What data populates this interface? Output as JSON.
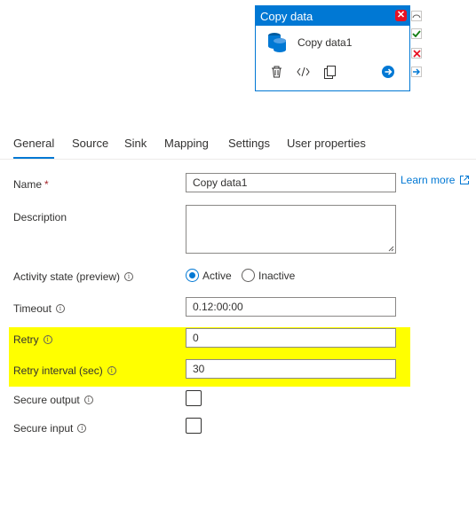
{
  "card": {
    "title": "Copy data",
    "activity_name": "Copy data1",
    "close_glyph": "✕",
    "icons": [
      "delete-icon",
      "code-icon",
      "copy-icon",
      "arrow-right-icon"
    ]
  },
  "tabs": [
    "General",
    "Source",
    "Sink",
    "Mapping",
    "Settings",
    "User properties"
  ],
  "form": {
    "name_label": "Name",
    "name_required": "*",
    "name_value": "Copy data1",
    "learn_more": "Learn more",
    "description_label": "Description",
    "description_value": "",
    "activity_state_label": "Activity state (preview)",
    "active_label": "Active",
    "inactive_label": "Inactive",
    "active_selected": true,
    "timeout_label": "Timeout",
    "timeout_value": "0.12:00:00",
    "retry_label": "Retry",
    "retry_value": "0",
    "retry_interval_label": "Retry interval (sec)",
    "retry_interval_value": "30",
    "secure_output_label": "Secure output",
    "secure_input_label": "Secure input",
    "secure_output_checked": false,
    "secure_input_checked": false,
    "info_glyph": "i"
  },
  "colors": {
    "accent": "#0078d4",
    "highlight": "#ffff00",
    "error": "#e81123",
    "success": "#107c10"
  }
}
